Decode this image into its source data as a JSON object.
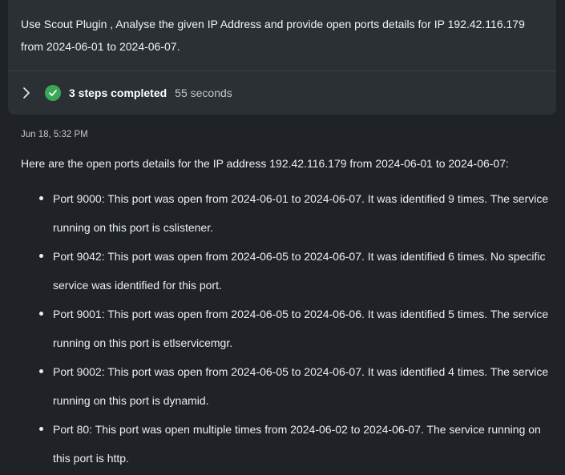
{
  "prompt": {
    "text": "Use Scout Plugin , Analyse the given IP Address and provide open ports details for IP 192.42.116.179 from 2024-06-01 to 2024-06-07."
  },
  "steps": {
    "label": "3 steps completed",
    "duration": "55 seconds",
    "expand_icon": "chevron-right-icon",
    "status_icon": "check-circle-icon",
    "status_color": "#3aa757"
  },
  "response": {
    "timestamp": "Jun 18, 5:32 PM",
    "intro": "Here are the open ports details for the IP address 192.42.116.179 from 2024-06-01 to 2024-06-07:",
    "ports": [
      "Port 9000: This port was open from 2024-06-01 to 2024-06-07. It was identified 9 times. The service running on this port is cslistener.",
      "Port 9042: This port was open from 2024-06-05 to 2024-06-07. It was identified 6 times. No specific service was identified for this port.",
      "Port 9001: This port was open from 2024-06-05 to 2024-06-06. It was identified 5 times. The service running on this port is etlservicemgr.",
      "Port 9002: This port was open from 2024-06-05 to 2024-06-07. It was identified 4 times. The service running on this port is dynamid.",
      "Port 80: This port was open multiple times from 2024-06-02 to 2024-06-07. The service running on this port is http."
    ]
  },
  "colors": {
    "background": "#1f2327",
    "card": "#2b3035",
    "text": "#eceff1"
  }
}
